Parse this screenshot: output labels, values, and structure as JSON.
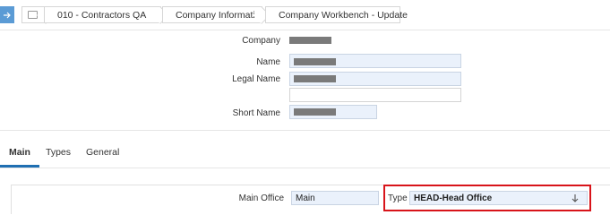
{
  "breadcrumb": {
    "items": [
      {
        "label": "010 - Contractors QA"
      },
      {
        "label": "Company Information"
      },
      {
        "label": "Company Workbench - Update"
      }
    ]
  },
  "form": {
    "company_label": "Company",
    "name_label": "Name",
    "legal_name_label": "Legal Name",
    "short_name_label": "Short Name"
  },
  "tabs": [
    {
      "label": "Main",
      "active": true
    },
    {
      "label": "Types",
      "active": false
    },
    {
      "label": "General",
      "active": false
    }
  ],
  "main": {
    "main_office_label": "Main Office",
    "main_office_value": "Main",
    "type_label": "Type",
    "type_value": "HEAD-Head Office"
  },
  "colors": {
    "accent": "#5b9bd5",
    "highlight": "#d8141a",
    "tab_underline": "#1f6fb2",
    "input_bg": "#eaf1fb"
  },
  "icons": {
    "nav": "arrow-right-icon",
    "home": "home-box-icon",
    "crumb_caret": "arrow-down-icon",
    "select_arrow": "arrow-down-icon"
  }
}
